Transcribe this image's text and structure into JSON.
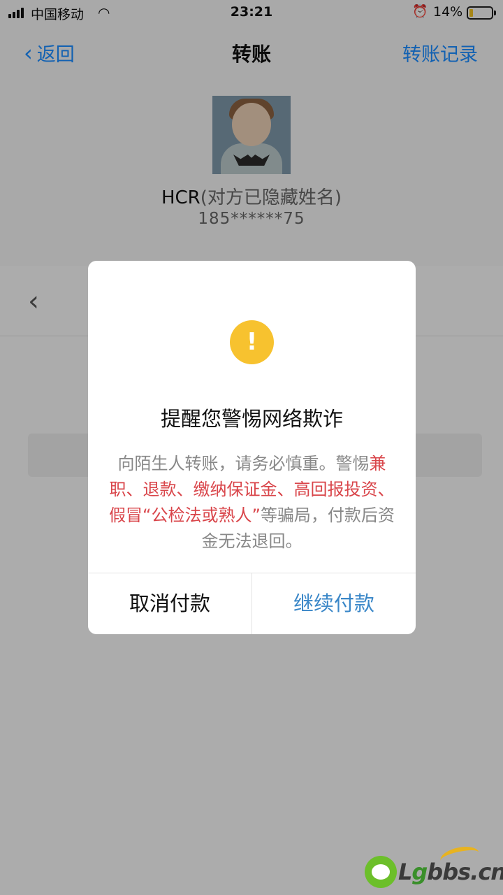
{
  "status_bar": {
    "carrier": "中国移动",
    "time": "23:21",
    "battery_percent": "14%",
    "battery_level": 0.14,
    "icons": [
      "signal-icon",
      "wifi-icon",
      "alarm-icon",
      "battery-icon"
    ]
  },
  "nav": {
    "back_label": "返回",
    "title": "转账",
    "record_label": "转账记录"
  },
  "recipient": {
    "name": "HCR",
    "name_note": "(对方已隐藏姓名)",
    "phone": "185******75"
  },
  "dialog": {
    "title": "提醒您警惕网络欺诈",
    "body_intro": "向陌生人转账，请务必慎重。警惕",
    "body_highlight": "兼职、退款、缴纳保证金、高回报投资、假冒“公检法或熟人”",
    "body_outro": "等骗局，付款后资金无法退回。",
    "cancel_label": "取消付款",
    "continue_label": "继续付款",
    "accent_color": "#3a87c8",
    "warning_color": "#f7c22f",
    "highlight_color": "#d9454a"
  },
  "watermark": {
    "text_prefix": "L",
    "text_g": "g",
    "text_suffix": "bbs.cn"
  }
}
